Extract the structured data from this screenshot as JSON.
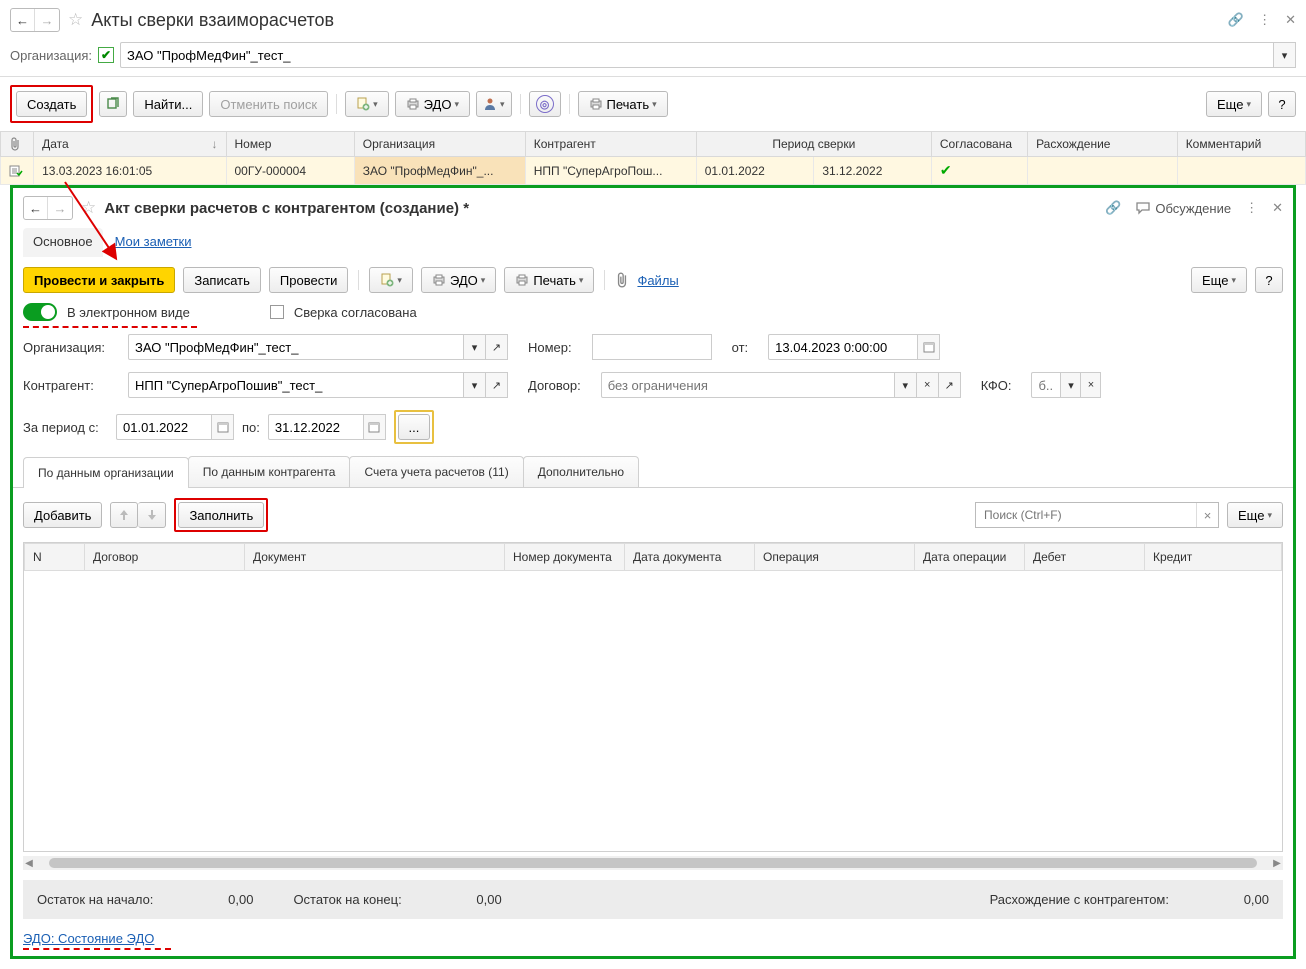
{
  "top": {
    "title": "Акты сверки взаиморасчетов",
    "org_label": "Организация:",
    "org_value": "ЗАО \"ПрофМедФин\"_тест_",
    "toolbar": {
      "create": "Создать",
      "find": "Найти...",
      "cancel_search": "Отменить поиск",
      "edo": "ЭДО",
      "print": "Печать",
      "more": "Еще",
      "help": "?"
    },
    "columns": {
      "date": "Дата",
      "number": "Номер",
      "org": "Организация",
      "counterparty": "Контрагент",
      "period": "Период сверки",
      "approved": "Согласована",
      "divergence": "Расхождение",
      "comment": "Комментарий"
    },
    "row": {
      "date": "13.03.2023 16:01:05",
      "number": "00ГУ-000004",
      "org": "ЗАО \"ПрофМедФин\"_...",
      "counterparty": "НПП \"СуперАгроПош...",
      "period_from": "01.01.2022",
      "period_to": "31.12.2022"
    }
  },
  "modal": {
    "title": "Акт сверки расчетов с контрагентом (создание) *",
    "discussion": "Обсуждение",
    "tab_main": "Основное",
    "tab_notes": "Мои заметки",
    "toolbar": {
      "post_close": "Провести и закрыть",
      "save": "Записать",
      "post": "Провести",
      "edo": "ЭДО",
      "print": "Печать",
      "files": "Файлы",
      "more": "Еще",
      "help": "?"
    },
    "switches": {
      "electronic": "В электронном виде",
      "approved": "Сверка согласована"
    },
    "form": {
      "org_label": "Организация:",
      "org_value": "ЗАО \"ПрофМедФин\"_тест_",
      "number_label": "Номер:",
      "from_label": "от:",
      "date_value": "13.04.2023 0:00:00",
      "cp_label": "Контрагент:",
      "cp_value": "НПП \"СуперАгроПошив\"_тест_",
      "contract_label": "Договор:",
      "contract_placeholder": "без ограничения",
      "kfo_label": "КФО:",
      "kfo_placeholder": "б...",
      "period_label": "За период с:",
      "period_from": "01.01.2022",
      "period_to_label": "по:",
      "period_to": "31.12.2022",
      "ellipsis": "..."
    },
    "itabs": {
      "org_data": "По данным организации",
      "cp_data": "По данным контрагента",
      "accounts": "Счета учета расчетов (11)",
      "additional": "Дополнительно"
    },
    "subtoolbar": {
      "add": "Добавить",
      "fill": "Заполнить",
      "search_placeholder": "Поиск (Ctrl+F)",
      "more": "Еще"
    },
    "datacols": {
      "n": "N",
      "contract": "Договор",
      "document": "Документ",
      "doc_number": "Номер документа",
      "doc_date": "Дата документа",
      "operation": "Операция",
      "op_date": "Дата операции",
      "debit": "Дебет",
      "credit": "Кредит"
    },
    "totals": {
      "start_label": "Остаток на начало:",
      "start_val": "0,00",
      "end_label": "Остаток на конец:",
      "end_val": "0,00",
      "diverg_label": "Расхождение с контрагентом:",
      "diverg_val": "0,00"
    },
    "edo_link": "ЭДО: Состояние ЭДО"
  }
}
